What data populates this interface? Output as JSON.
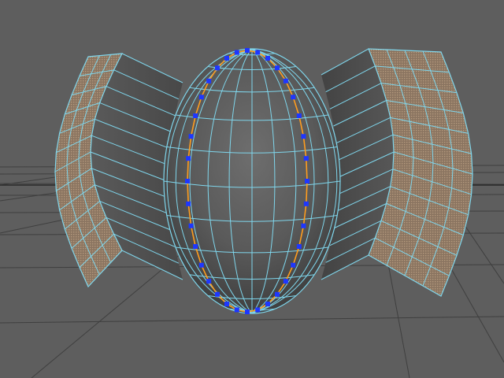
{
  "viewport": {
    "background_color": "#5e5e5e",
    "grid_color": "#3f3f3f",
    "wire_color": "#7fd6ec",
    "face_color": "#8c7a66",
    "edge_loop_color": "#ff9d1e",
    "vertex_color": "#1e37ff"
  },
  "model": {
    "object": "sphere-with-extruded-side-caps",
    "edge_loop_selected": true
  }
}
